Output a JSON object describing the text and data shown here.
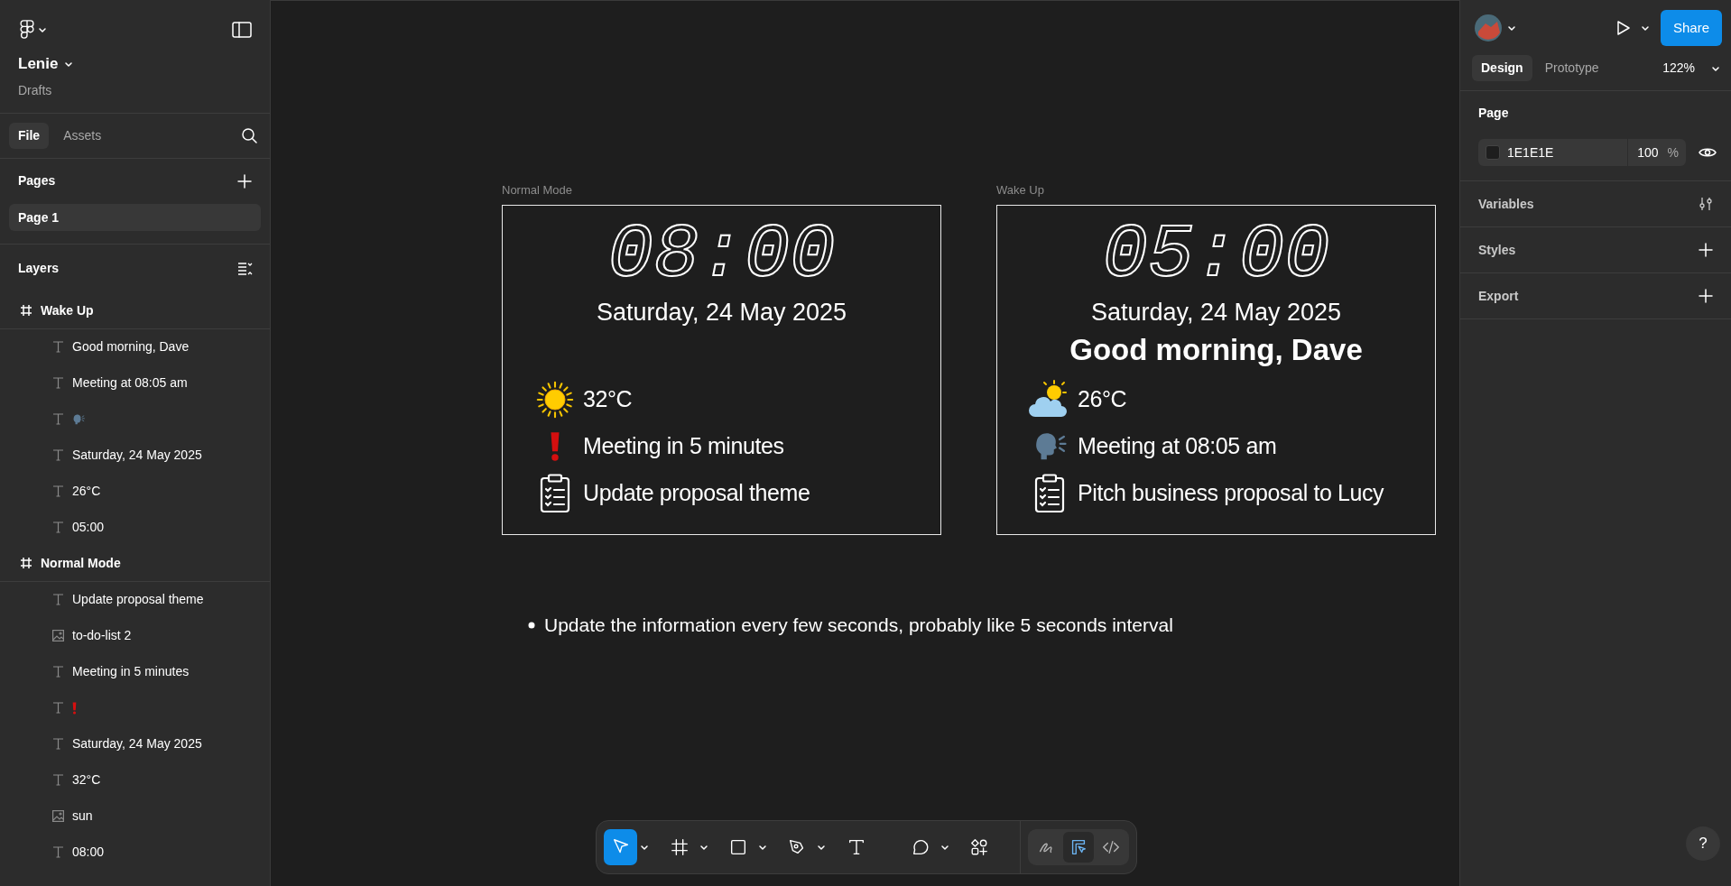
{
  "file": {
    "name": "Lenie",
    "location": "Drafts"
  },
  "left_tabs": [
    {
      "label": "File",
      "selected": true
    },
    {
      "label": "Assets",
      "selected": false
    }
  ],
  "pages": {
    "title": "Pages",
    "items": [
      {
        "label": "Page 1",
        "selected": true
      }
    ]
  },
  "layers": {
    "title": "Layers",
    "items": [
      {
        "kind": "frame",
        "name": "Wake Up",
        "children": [
          {
            "kind": "text",
            "name": "Good morning, Dave"
          },
          {
            "kind": "text",
            "name": "Meeting at 08:05 am"
          },
          {
            "kind": "speaking-head"
          },
          {
            "kind": "text",
            "name": "Saturday, 24 May 2025"
          },
          {
            "kind": "text",
            "name": "26°C"
          },
          {
            "kind": "text",
            "name": "05:00"
          }
        ]
      },
      {
        "kind": "frame",
        "name": "Normal Mode",
        "children": [
          {
            "kind": "text",
            "name": "Update proposal theme"
          },
          {
            "kind": "image",
            "name": "to-do-list 2"
          },
          {
            "kind": "text",
            "name": "Meeting in 5 minutes"
          },
          {
            "kind": "exclamation"
          },
          {
            "kind": "text",
            "name": "Saturday, 24 May 2025"
          },
          {
            "kind": "text",
            "name": "32°C"
          },
          {
            "kind": "image",
            "name": "sun"
          },
          {
            "kind": "text",
            "name": "08:00"
          }
        ]
      }
    ]
  },
  "frames": [
    {
      "label": "Normal Mode",
      "time": "08:00",
      "date": "Saturday, 24 May 2025",
      "rows": [
        {
          "kind": "sun",
          "text": "32°C"
        },
        {
          "kind": "alert",
          "text": "Meeting in 5 minutes"
        },
        {
          "kind": "todo",
          "text": "Update proposal theme"
        }
      ]
    },
    {
      "label": "Wake Up",
      "time": "05:00",
      "date": "Saturday, 24 May 2025",
      "greeting": "Good morning, Dave",
      "rows": [
        {
          "kind": "cloud-sun",
          "text": "26°C"
        },
        {
          "kind": "speech",
          "text": "Meeting at 08:05 am"
        },
        {
          "kind": "todo",
          "text": "Pitch business proposal to Lucy"
        }
      ]
    }
  ],
  "notes": [
    "Update the information every few seconds, probably like 5 seconds interval"
  ],
  "toolbar": {
    "tools": [
      {
        "kind": "move",
        "selected": true,
        "menu": true
      },
      {
        "kind": "frame",
        "selected": false,
        "menu": true
      },
      {
        "kind": "rectangle",
        "selected": false,
        "menu": true
      },
      {
        "kind": "pen",
        "selected": false,
        "menu": true
      },
      {
        "kind": "text",
        "selected": false,
        "menu": false
      },
      {
        "kind": "comment",
        "selected": false,
        "menu": true
      },
      {
        "kind": "actions",
        "selected": false,
        "menu": false
      }
    ],
    "modes": [
      {
        "kind": "draw",
        "selected": false
      },
      {
        "kind": "design",
        "selected": true
      },
      {
        "kind": "dev",
        "selected": false
      }
    ]
  },
  "right_panel": {
    "share": "Share",
    "tabs": [
      {
        "label": "Design",
        "selected": true
      },
      {
        "label": "Prototype",
        "selected": false
      }
    ],
    "zoom": "122%",
    "page": {
      "title": "Page",
      "fill": "1E1E1E",
      "opacity": "100",
      "unit": "%"
    },
    "sections": [
      {
        "title": "Variables",
        "kind": "variables"
      },
      {
        "title": "Styles",
        "kind": "add"
      },
      {
        "title": "Export",
        "kind": "add"
      }
    ]
  },
  "help": "?"
}
